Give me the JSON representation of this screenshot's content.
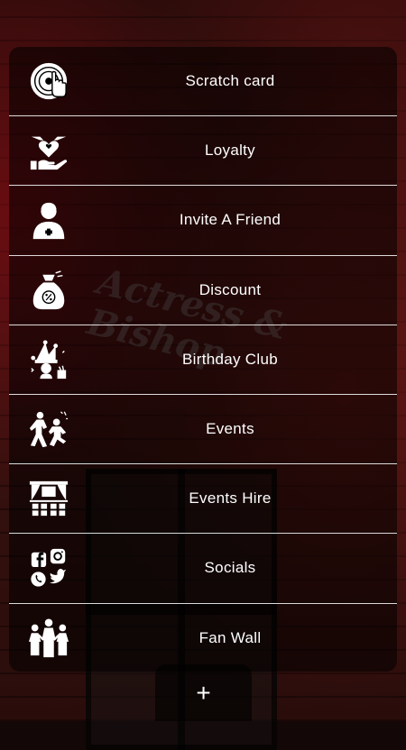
{
  "menu": {
    "items": [
      {
        "label": "Scratch card",
        "icon": "scratch-card-icon"
      },
      {
        "label": "Loyalty",
        "icon": "loyalty-icon"
      },
      {
        "label": "Invite A Friend",
        "icon": "invite-friend-icon"
      },
      {
        "label": "Discount",
        "icon": "discount-icon"
      },
      {
        "label": "Birthday Club",
        "icon": "birthday-club-icon"
      },
      {
        "label": "Events",
        "icon": "events-icon"
      },
      {
        "label": "Events Hire",
        "icon": "events-hire-icon"
      },
      {
        "label": "Socials",
        "icon": "socials-icon"
      },
      {
        "label": "Fan Wall",
        "icon": "fan-wall-icon"
      }
    ]
  },
  "fab": {
    "label": "+"
  },
  "background": {
    "sign_text": "Actress & Bishop"
  },
  "colors": {
    "text": "#ffffff",
    "divider": "#ffffff",
    "panel": "#000000"
  }
}
